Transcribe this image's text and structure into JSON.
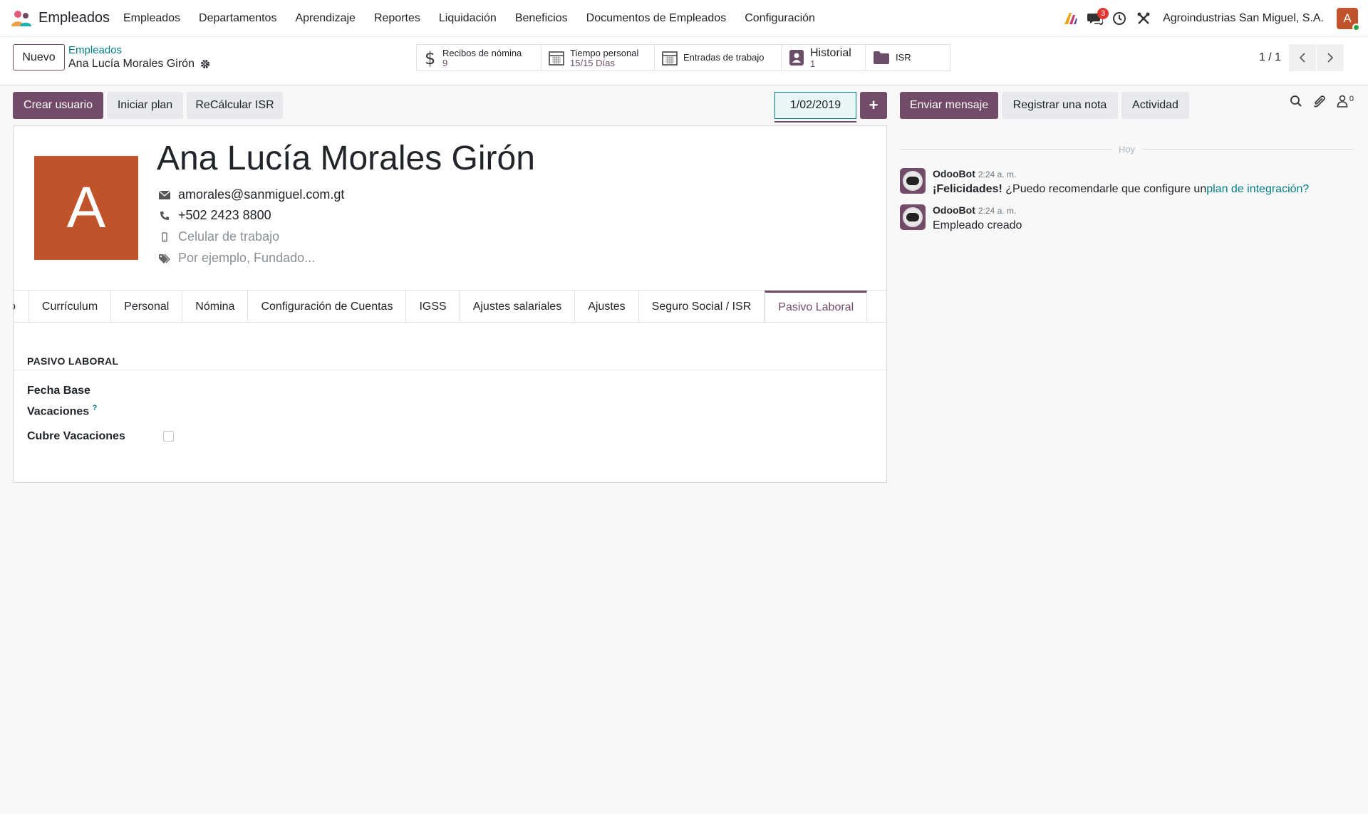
{
  "app": {
    "name": "Empleados"
  },
  "menu": [
    "Empleados",
    "Departamentos",
    "Aprendizaje",
    "Reportes",
    "Liquidación",
    "Beneficios",
    "Documentos de Empleados",
    "Configuración"
  ],
  "navbar": {
    "messages_badge": "3",
    "company": "Agroindustrias San Miguel, S.A.",
    "user_initial": "A"
  },
  "control_panel": {
    "new_label": "Nuevo",
    "breadcrumb_parent": "Empleados",
    "breadcrumb_current": "Ana Lucía Morales Girón",
    "pager": "1 / 1"
  },
  "stats": {
    "payslips": {
      "label": "Recibos de nómina",
      "value": "9"
    },
    "time_off": {
      "label": "Tiempo personal",
      "value": "15/15 Días"
    },
    "work_entries": {
      "label": "Entradas de trabajo"
    },
    "history": {
      "label": "Historial",
      "value": "1"
    },
    "isr": {
      "label": "ISR"
    }
  },
  "actions": {
    "create_user": "Crear usuario",
    "start_plan": "Iniciar plan",
    "recalc_isr": "ReCálcular ISR",
    "date": "1/02/2019",
    "plus": "+"
  },
  "employee": {
    "initial": "A",
    "name": "Ana Lucía Morales Girón",
    "email": "amorales@sanmiguel.com.gt",
    "phone": "+502 2423 8800",
    "mobile_placeholder": "Celular de trabajo",
    "tags_placeholder": "Por ejemplo, Fundado..."
  },
  "tabs": [
    "o",
    "Currículum",
    "Personal",
    "Nómina",
    "Configuración de Cuentas",
    "IGSS",
    "Ajustes salariales",
    "Ajustes",
    "Seguro Social / ISR",
    "Pasivo Laboral"
  ],
  "active_tab": "Pasivo Laboral",
  "section": {
    "title": "PASIVO LABORAL",
    "field1_line1": "Fecha Base",
    "field1_line2": "Vacaciones",
    "field1_help": "?",
    "field2": "Cubre Vacaciones",
    "field2_checked": false
  },
  "chatter": {
    "send_message": "Enviar mensaje",
    "log_note": "Registrar una nota",
    "activity": "Actividad",
    "followers_count": "0",
    "today": "Hoy",
    "messages": [
      {
        "author": "OdooBot",
        "time": "2:24 a. m.",
        "bold": "¡Felicidades!",
        "text": " ¿Puedo recomendarle que configure un",
        "link": "plan de integración?"
      },
      {
        "author": "OdooBot",
        "time": "2:24 a. m.",
        "text": "Empleado creado"
      }
    ]
  },
  "colors": {
    "brand": "#714b67",
    "teal": "#017e84",
    "avatar": "#c0532a"
  }
}
